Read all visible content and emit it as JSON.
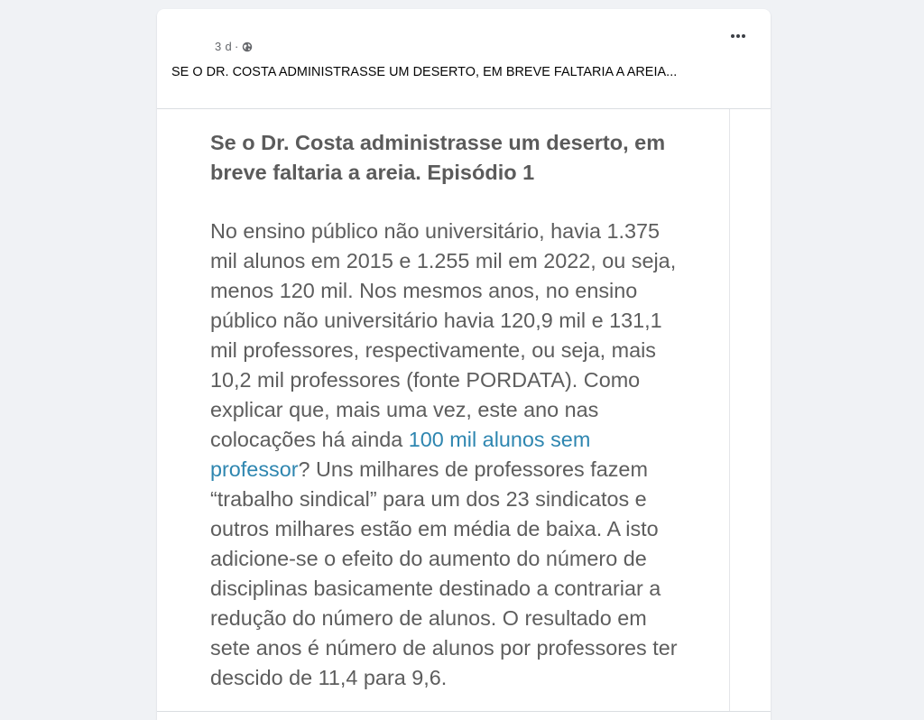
{
  "post": {
    "time": "3 d",
    "separator": "·",
    "privacy_icon": "globe-icon",
    "more_icon": "ellipsis-icon",
    "caption": "SE O DR. COSTA ADMINISTRASSE UM DESERTO, EM BREVE FALTARIA A AREIA..."
  },
  "image": {
    "title_line1": "Se o Dr. Costa administrasse um deserto, em",
    "title_line2": "breve faltaria a areia. Episódio 1",
    "body": [
      "No ensino público não universitário, havia 1.375",
      "mil alunos em 2015 e 1.255 mil em 2022, ou seja,",
      "menos 120 mil. Nos mesmos anos, no ensino",
      "público não universitário havia 120,9 mil e 131,1",
      "mil professores, respectivamente, ou seja, mais",
      "10,2 mil professores (fonte PORDATA). Como",
      "explicar que, mais uma vez, este ano nas"
    ],
    "line8_prefix": "colocações há ainda ",
    "link_part1": "100 mil alunos sem",
    "link_part2": "professor",
    "line9_suffix": "? Uns milhares de professores fazem",
    "body_rest": [
      "“trabalho sindical” para um dos 23 sindicatos e",
      "outros milhares estão em média de baixa. A isto",
      "adicione-se o efeito do aumento do número de",
      "disciplinas basicamente destinado a contrariar a",
      "redução do número de alunos. O resultado em",
      "sete anos é número de alunos por professores ter",
      "descido de 11,4 para 9,6."
    ],
    "link_color": "#2e86b0",
    "text_color": "#5d5d5d"
  }
}
